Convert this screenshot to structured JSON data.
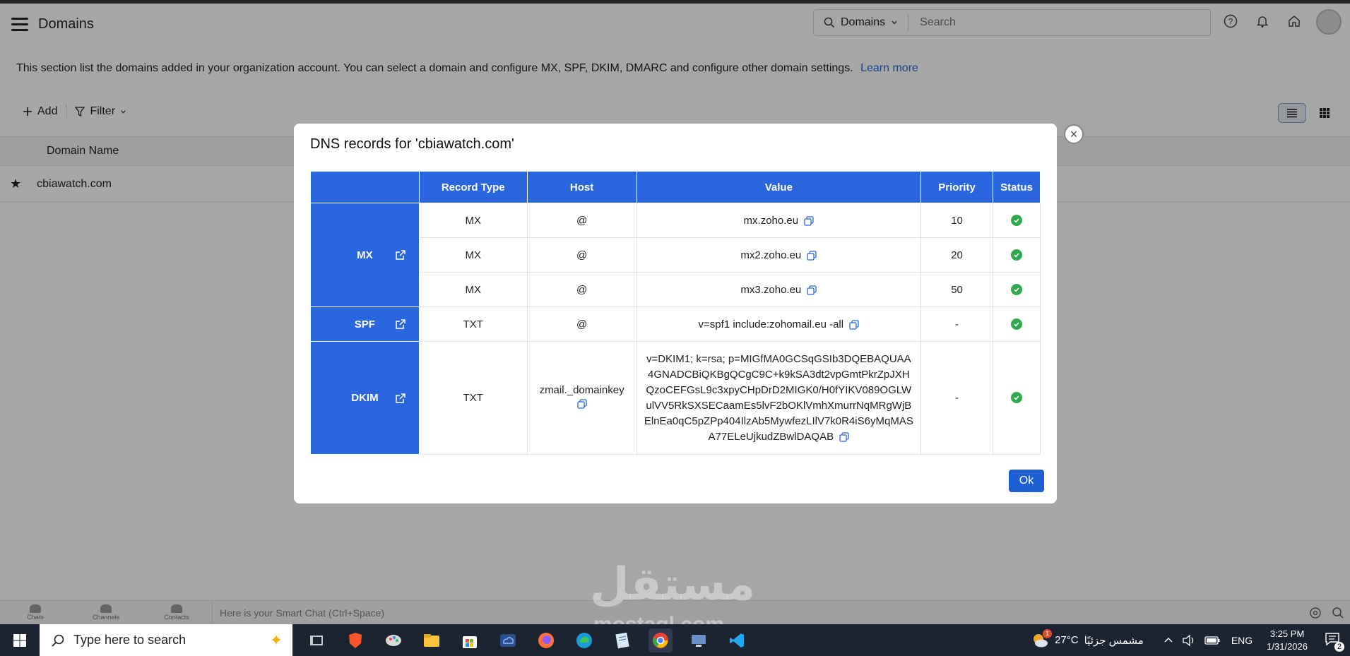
{
  "app": {
    "title": "Domains",
    "search_scope": "Domains",
    "search_placeholder": "Search"
  },
  "description": {
    "text": "This section list the domains added in your organization account. You can select a domain and configure MX, SPF, DKIM, DMARC and configure other domain settings.",
    "link": "Learn more"
  },
  "toolbar": {
    "add_label": "Add",
    "filter_label": "Filter"
  },
  "table": {
    "column_domain_name": "Domain Name",
    "rows": [
      {
        "domain": "cbiawatch.com"
      }
    ]
  },
  "modal": {
    "title": "DNS records for 'cbiawatch.com'",
    "headers": [
      "",
      "Record Type",
      "Host",
      "Value",
      "Priority",
      "Status"
    ],
    "groups": {
      "mx": "MX",
      "spf": "SPF",
      "dkim": "DKIM"
    },
    "records": [
      {
        "type": "MX",
        "host": "@",
        "value": "mx.zoho.eu",
        "priority": "10"
      },
      {
        "type": "MX",
        "host": "@",
        "value": "mx2.zoho.eu",
        "priority": "20"
      },
      {
        "type": "MX",
        "host": "@",
        "value": "mx3.zoho.eu",
        "priority": "50"
      },
      {
        "type": "TXT",
        "host": "@",
        "value": "v=spf1 include:zohomail.eu -all",
        "priority": "-"
      },
      {
        "type": "TXT",
        "host": "zmail._domainkey",
        "value": "v=DKIM1; k=rsa; p=MIGfMA0GCSqGSIb3DQEBAQUAA4GNADCBiQKBgQCgC9C+k9kSA3dt2vpGmtPkrZpJXHQzoCEFGsL9c3xpyCHpDrD2MIGK0/H0fYIKV089OGLWulVV5RkSXSECaamEs5lvF2bOKlVmhXmurrNqMRgWjBElnEa0qC5pZPp404IlzAb5MywfezLIlV7k0R4iS6yMqMASA77ELeUjkudZBwlDAQAB",
        "priority": "-"
      }
    ],
    "ok_label": "Ok"
  },
  "smart_chat": {
    "tabs": [
      "Chats",
      "Channels",
      "Contacts"
    ],
    "placeholder": "Here is your Smart Chat (Ctrl+Space)"
  },
  "watermark": {
    "arabic": "مستقل",
    "latin": "mostaql.com"
  },
  "taskbar": {
    "search_text": "Type here to search",
    "weather_temp": "27°C",
    "weather_text": "مشمس جزئيًا",
    "language": "ENG",
    "time": "3:25 PM",
    "date": "1/31/2026",
    "notification_count": "2",
    "weather_badge": "1"
  },
  "colors": {
    "accent": "#2a66dd",
    "ok_button": "#1f5fd3",
    "status_ok": "#2fa84f",
    "link": "#2a6ad3"
  }
}
